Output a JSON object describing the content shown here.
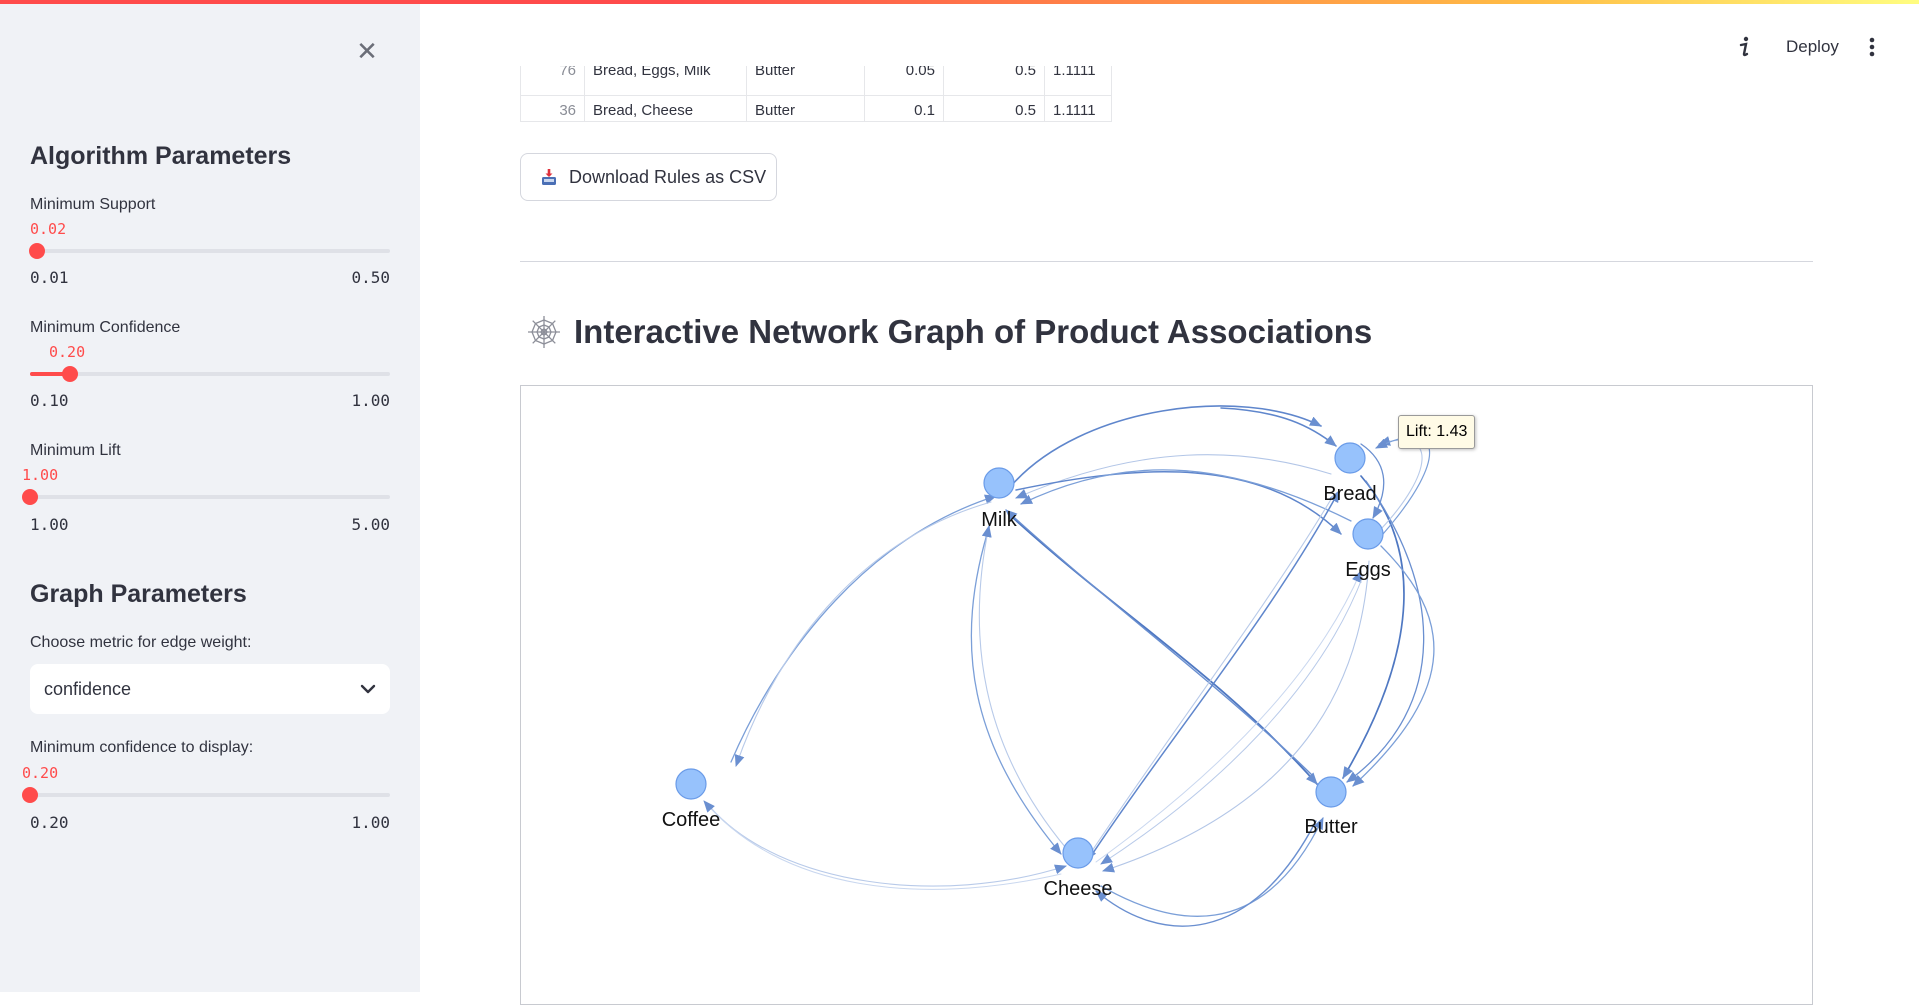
{
  "sidebar": {
    "algorithm_heading": "Algorithm Parameters",
    "min_support": {
      "label": "Minimum Support",
      "value": "0.02",
      "min": "0.01",
      "max": "0.50",
      "fraction": 0.0204
    },
    "min_confidence": {
      "label": "Minimum Confidence",
      "value": "0.20",
      "min": "0.10",
      "max": "1.00",
      "fraction": 0.111
    },
    "min_lift": {
      "label": "Minimum Lift",
      "value": "1.00",
      "min": "1.00",
      "max": "5.00",
      "fraction": 0.0
    },
    "graph_heading": "Graph Parameters",
    "metric_select": {
      "label": "Choose metric for edge weight:",
      "value": "confidence"
    },
    "min_display": {
      "label": "Minimum confidence to display:",
      "value": "0.20",
      "min": "0.20",
      "max": "1.00",
      "fraction": 0.0
    }
  },
  "header": {
    "deploy_label": "Deploy"
  },
  "table": {
    "rows": [
      [
        "76",
        "Bread, Eggs, Milk",
        "Butter",
        "0.05",
        "0.5",
        "1.1111"
      ],
      [
        "36",
        "Bread, Cheese",
        "Butter",
        "0.1",
        "0.5",
        "1.1111"
      ]
    ]
  },
  "download_button": {
    "label": "Download Rules as CSV"
  },
  "network": {
    "title": "Interactive Network Graph of Product Associations",
    "tooltip": "Lift: 1.43",
    "nodes": [
      "Milk",
      "Bread",
      "Eggs",
      "Coffee",
      "Butter",
      "Cheese"
    ],
    "colors": {
      "node": "#97c2fc",
      "edge": "#6a8fd0",
      "accent": "#ff4b4b"
    }
  }
}
